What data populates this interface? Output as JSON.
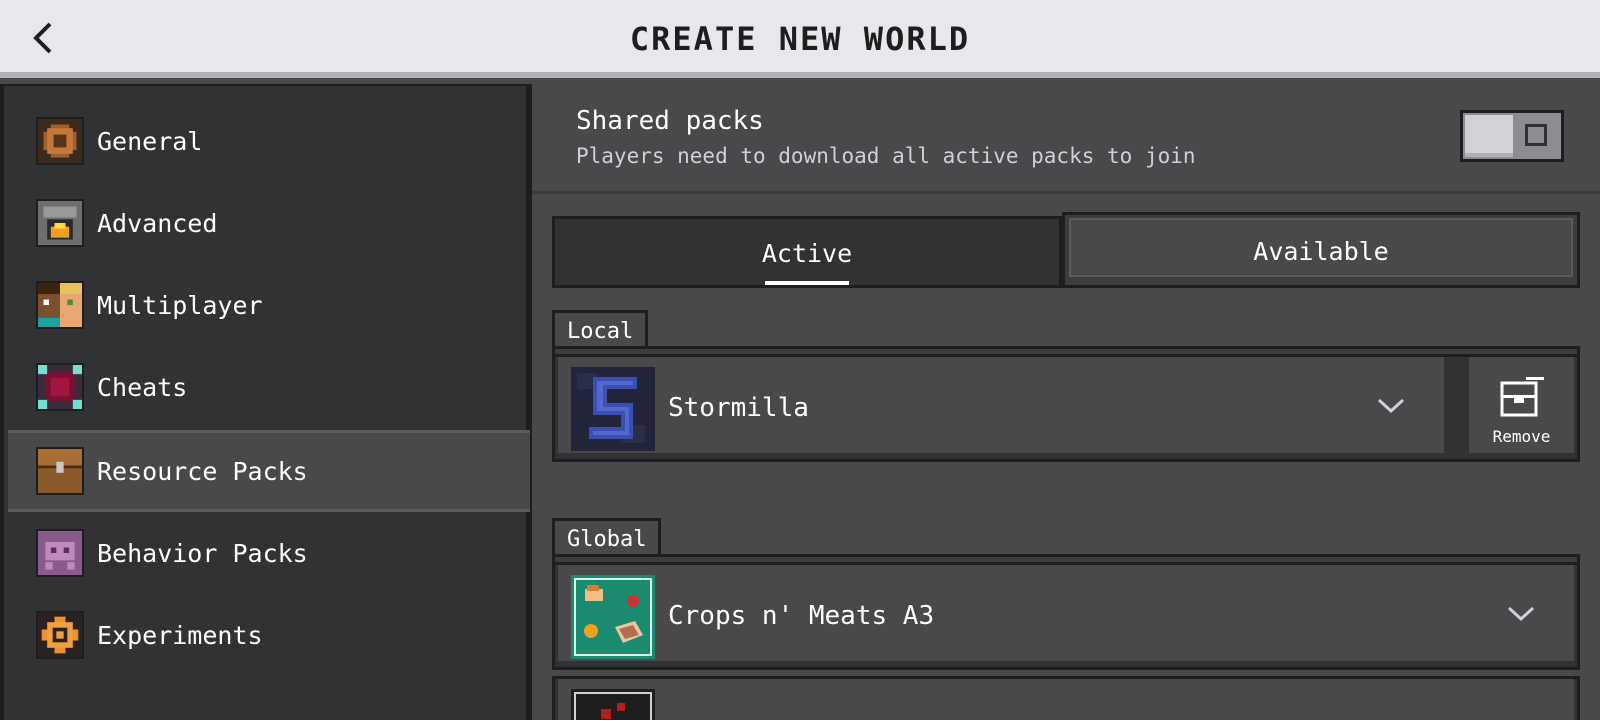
{
  "header": {
    "title": "CREATE NEW WORLD"
  },
  "sidebar": {
    "items": [
      {
        "label": "General",
        "icon": "gear-icon"
      },
      {
        "label": "Advanced",
        "icon": "furnace-icon"
      },
      {
        "label": "Multiplayer",
        "icon": "players-icon"
      },
      {
        "label": "Cheats",
        "icon": "cheats-icon"
      },
      {
        "label": "Resource Packs",
        "icon": "chest-icon",
        "selected": true
      },
      {
        "label": "Behavior Packs",
        "icon": "behavior-icon"
      },
      {
        "label": "Experiments",
        "icon": "experiments-icon"
      }
    ]
  },
  "shared_packs": {
    "title": "Shared packs",
    "description": "Players need to download all active packs to join",
    "enabled": false
  },
  "tabs": {
    "active": "Active",
    "available": "Available"
  },
  "local": {
    "label": "Local",
    "packs": [
      {
        "name": "Stormilla",
        "remove_label": "Remove"
      }
    ]
  },
  "global": {
    "label": "Global",
    "packs": [
      {
        "name": "Crops n' Meats A3"
      }
    ]
  },
  "colors": {
    "panel": "#48494a",
    "sidebar": "#313233",
    "header": "#e6e8eb",
    "border": "#1e1e1f"
  }
}
